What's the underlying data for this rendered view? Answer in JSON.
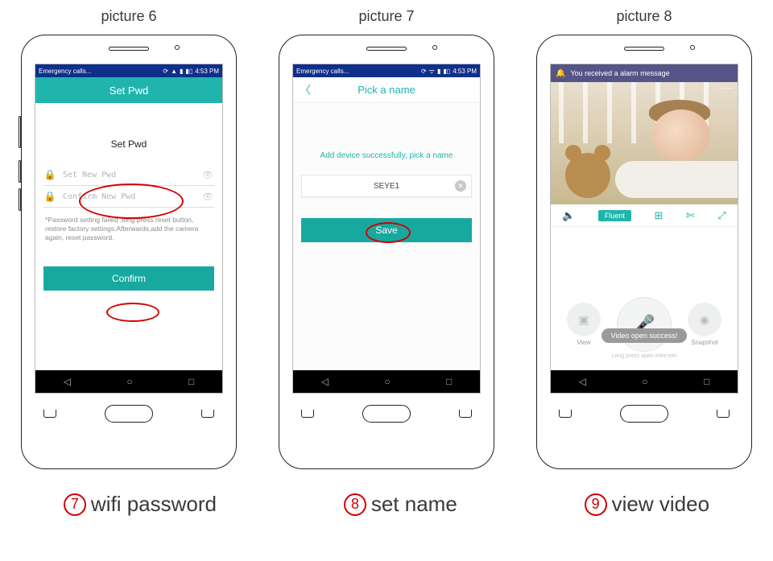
{
  "labels": {
    "pic6": "picture 6",
    "pic7": "picture 7",
    "pic8": "picture 8"
  },
  "status": {
    "left": "Emergency calls... ",
    "time": "4:53 PM"
  },
  "screen1": {
    "header": "Set Pwd",
    "title": "Set Pwd",
    "new_pwd_placeholder": "Set New Pwd",
    "confirm_pwd_placeholder": "Confirm New Pwd",
    "note": "*Password setting failed ,long press reset button, restore factory settings.Afterwards,add the camera again, reset password.",
    "confirm": "Confirm"
  },
  "screen2": {
    "header": "Pick a name",
    "message": "Add device successfully, pick a name",
    "input_value": "SEYE1",
    "save": "Save"
  },
  "screen3": {
    "alert": "You received a alarm message",
    "quality_chip": "Fluent",
    "view_label": "View",
    "snapshot_label": "Snapshot",
    "toast": "Video open success!",
    "hint": "Long press open intercom"
  },
  "captions": {
    "n7": "7",
    "t7": "wifi password",
    "n8": "8",
    "t8": "set name",
    "n9": "9",
    "t9": "view video"
  }
}
